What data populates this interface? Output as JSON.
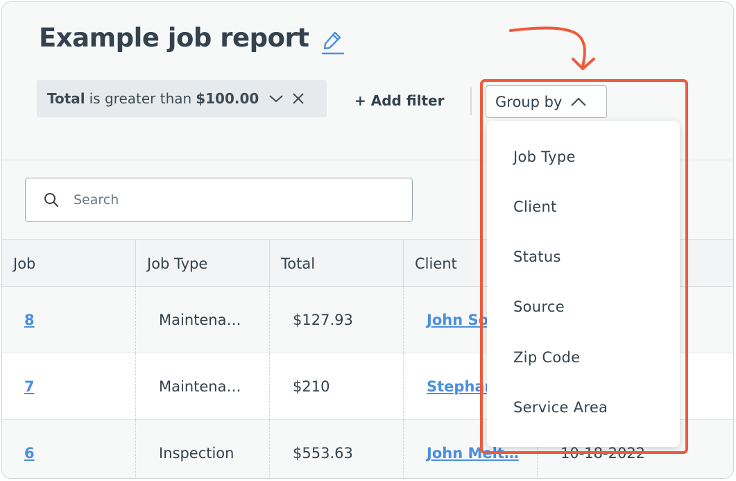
{
  "report": {
    "title": "Example job report"
  },
  "filter": {
    "field": "Total",
    "operator": "is greater than",
    "value": "$100.00"
  },
  "toolbar": {
    "add_filter_label": "+ Add filter",
    "group_by_label": "Group by"
  },
  "search": {
    "placeholder": "Search"
  },
  "table": {
    "columns": [
      "Job",
      "Job Type",
      "Total",
      "Client"
    ],
    "rows": [
      {
        "job": "8",
        "job_type": "Maintena…",
        "total": "$127.93",
        "client": "John So",
        "date": ""
      },
      {
        "job": "7",
        "job_type": "Maintena…",
        "total": "$210",
        "client": "Stephan",
        "date": ""
      },
      {
        "job": "6",
        "job_type": "Inspection",
        "total": "$553.63",
        "client": "John Melt…",
        "date": "10-18-2022"
      }
    ]
  },
  "group_by_menu": {
    "options": [
      "Job Type",
      "Client",
      "Status",
      "Source",
      "Zip Code",
      "Service Area"
    ]
  },
  "colors": {
    "annotation": "#ee5a3a",
    "link": "#4a8fe0",
    "text": "#34424d"
  }
}
